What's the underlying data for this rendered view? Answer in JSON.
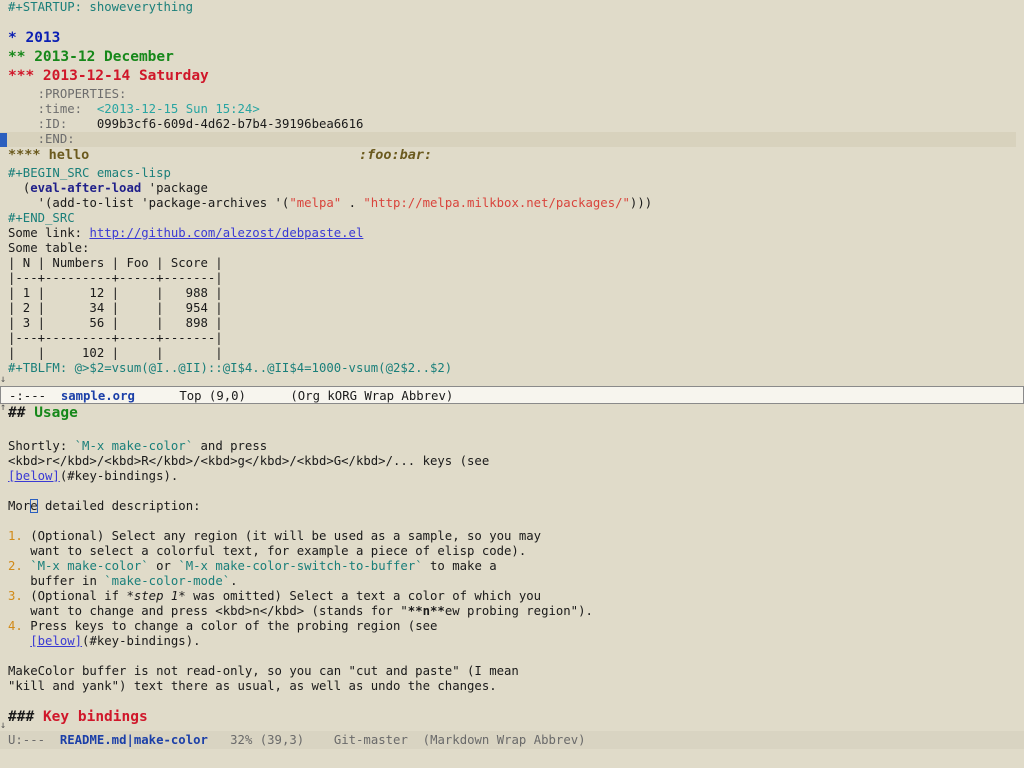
{
  "top_window": {
    "startup": "#+STARTUP: showeverything",
    "h1": "* 2013",
    "h2": "** 2013-12 December",
    "h3": "*** 2013-12-14 Saturday",
    "properties_key": ":PROPERTIES:",
    "time_key": ":time:",
    "time_value": "<2013-12-15 Sun 15:24>",
    "id_key": ":ID:",
    "id_value": "099b3cf6-609d-4d62-b7b4-39196bea6616",
    "end_key": ":END:",
    "h4_stars": "****",
    "h4_title": "hello",
    "h4_tags": ":foo:bar:",
    "src_begin": "#+BEGIN_SRC emacs-lisp",
    "src_line1_open": "(",
    "src_line1_kw": "eval-after-load",
    "src_line1_rest": " 'package",
    "src_line2_a": "'(add-to-list 'package-archives '(",
    "src_line2_str1": "\"melpa\"",
    "src_line2_dot": " . ",
    "src_line2_str2": "\"http://melpa.milkbox.net/packages/\"",
    "src_line2_close": ")))",
    "src_end": "#+END_SRC",
    "link_label": "Some link: ",
    "link_url": "http://github.com/alezost/debpaste.el",
    "table_label": "Some table:",
    "table_rows": [
      "| N | Numbers | Foo | Score |",
      "|---+---------+-----+-------|",
      "| 1 |      12 |     |   988 |",
      "| 2 |      34 |     |   954 |",
      "| 3 |      56 |     |   898 |",
      "|---+---------+-----+-------|",
      "|   |     102 |     |       |"
    ],
    "tblfm": "#+TBLFM: @>$2=vsum(@I..@II)::@I$4..@II$4=1000-vsum(@2$2..$2)"
  },
  "top_modeline": {
    "status": "-:---",
    "buffer": "sample.org",
    "position": "Top (9,0)",
    "modes": "(Org kORG Wrap Abbrev)"
  },
  "bottom_window": {
    "h2_hash": "##",
    "h2_title": "Usage",
    "p1_a": "Shortly: ",
    "p1_code": "`M-x make-color`",
    "p1_b": " and press",
    "p1_line2": "<kbd>r</kbd>/<kbd>R</kbd>/<kbd>g</kbd>/<kbd>G</kbd>/... keys (see",
    "p1_link": "[below]",
    "p1_link_target": "(#key-bindings).",
    "p2_a": "Mor",
    "p2_cursor": "e",
    "p2_b": " detailed description:",
    "item1_num": "1.",
    "item1_l1": "(Optional) Select any region (it will be used as a sample, so you may",
    "item1_l2": "want to select a colorful text, for example a piece of elisp code).",
    "item2_num": "2.",
    "item2_code1": "`M-x make-color`",
    "item2_or": " or ",
    "item2_code2": "`M-x make-color-switch-to-buffer`",
    "item2_rest": " to make a",
    "item2_l2a": "buffer in ",
    "item2_l2code": "`make-color-mode`",
    "item2_l2b": ".",
    "item3_num": "3.",
    "item3_a": "(Optional if ",
    "item3_em": "*step 1*",
    "item3_b": " was omitted) Select a text a color of which you",
    "item3_l2a": "want to change and press <kbd>n</kbd> (stands for \"",
    "item3_l2b": "**n**",
    "item3_l2c": "ew probing region\").",
    "item4_num": "4.",
    "item4_l1": "Press keys to change a color of the probing region (see",
    "item4_link": "[below]",
    "item4_target": "(#key-bindings).",
    "p3_l1": "MakeColor buffer is not read-only, so you can \"cut and paste\" (I mean",
    "p3_l2": "\"kill and yank\") text there as usual, as well as undo the changes.",
    "h3_hash": "###",
    "h3_title": "Key bindings"
  },
  "bottom_modeline": {
    "status": "U:---",
    "buffer": "README.md|make-color",
    "position": "32% (39,3)",
    "vc": "Git-master",
    "modes": "(Markdown Wrap Abbrev)"
  },
  "colors": {
    "background": "#e0dbc9",
    "heading1": "#0b1fb3",
    "heading2": "#16881a",
    "heading3": "#d0172a",
    "link": "#3a3ad4",
    "string": "#d9443c"
  }
}
